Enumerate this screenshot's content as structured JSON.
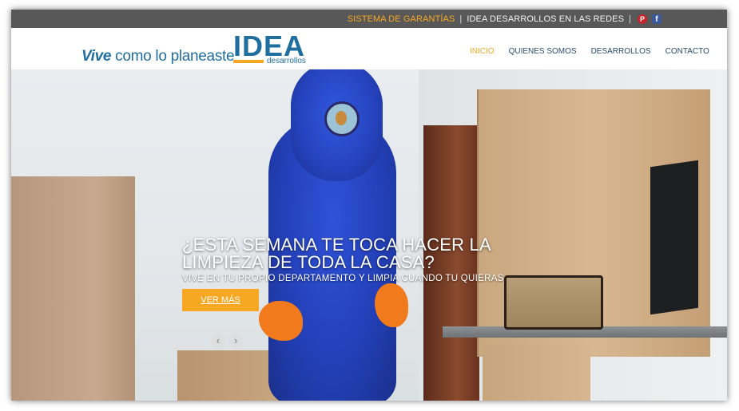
{
  "topbar": {
    "warranty_link": "SISTEMA DE GARANTÍAS",
    "separator": "|",
    "social_text": "IDEA DESARROLLOS EN LAS REDES",
    "pinterest_glyph": "P",
    "facebook_glyph": "f",
    "icons": [
      "pinterest-icon",
      "facebook-icon"
    ]
  },
  "header": {
    "tagline_vive": "Vive",
    "tagline_rest": " como lo planeaste",
    "logo_main": "IDEA",
    "logo_sub": "desarrollos"
  },
  "nav": {
    "items": [
      {
        "label": "INICIO",
        "active": true
      },
      {
        "label": "QUIENES SOMOS",
        "active": false
      },
      {
        "label": "DESARROLLOS",
        "active": false
      },
      {
        "label": "CONTACTO",
        "active": false
      }
    ]
  },
  "hero": {
    "headline_line1": "¿ESTA SEMANA TE TOCA HACER LA",
    "headline_line2": "LIMPIEZA DE TODA LA CASA?",
    "subhead": "VIVE EN TU PROPIO DEPARTAMENTO Y LIMPIA CUANDO TU QUIERAS",
    "cta_label": "VER MÁS",
    "prev_arrow": "‹",
    "next_arrow": "›"
  },
  "colors": {
    "accent_orange": "#f7a823",
    "brand_blue": "#1f6ea0",
    "topbar_bg": "#585858"
  }
}
